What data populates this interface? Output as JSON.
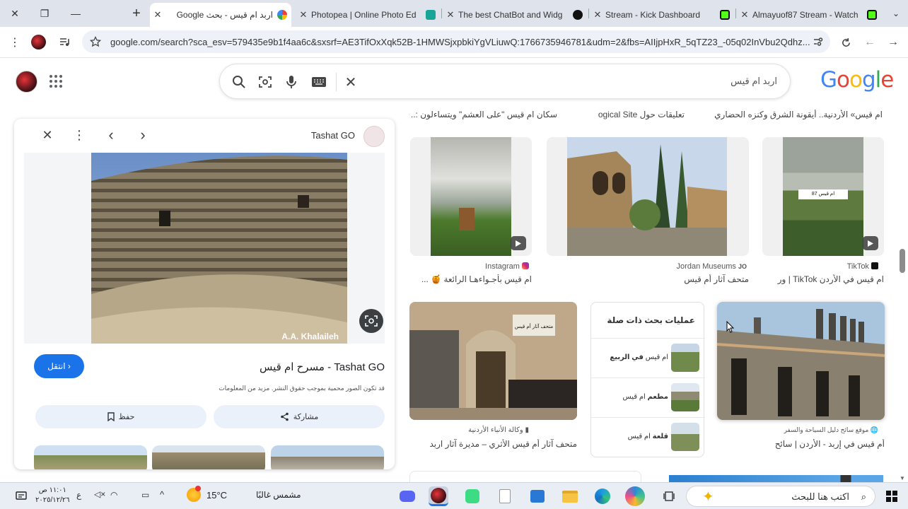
{
  "browser": {
    "tabs": [
      {
        "title": "اربد ام قيس - بحث Google",
        "active": true
      },
      {
        "title": "Photopea | Online Photo Ed",
        "active": false
      },
      {
        "title": "The best ChatBot and Widg",
        "active": false
      },
      {
        "title": "Stream - Kick Dashboard",
        "active": false
      },
      {
        "title": "Almayuof87 Stream - Watch",
        "active": false
      }
    ],
    "url": "google.com/search?sca_esv=579435e9b1f4aa6c&sxsrf=AE3TifOxXqk52B-1HMWSjxpbkiYgVLiuwQ:1766735946781&udm=2&fbs=AIIjpHxR_5qTZ23_-05q02InVbu2Qdhz..."
  },
  "search": {
    "query": "اربد ام قيس",
    "logo": "Google",
    "logo_colors": [
      "#4285F4",
      "#EA4335",
      "#FBBC05",
      "#4285F4",
      "#34A853",
      "#EA4335"
    ]
  },
  "panel": {
    "source": "Tashat GO",
    "visit_label": "انتقل",
    "title": "مسرح ام قيس - Tashat GO",
    "note": "قد تكون الصور محمية بموجب حقوق النشر. مزيد من المعلومات",
    "save_label": "حفظ",
    "share_label": "مشاركة",
    "watermark": "A.A. Khalaileh"
  },
  "top_captions": [
    "ام قيس» الأردنية.. أيقونة الشرق وكنزه الحضاري",
    "تعليقات حول ogical Site",
    "سكان ام قيس \"على العشم\" ويتساءلون :..."
  ],
  "results": [
    {
      "source": "TikTok",
      "caption": "ام قيس في الأردن TikTok | ور"
    },
    {
      "source": "Jordan Museums",
      "caption": "متحف آثار أم قيس"
    },
    {
      "source": "Instagram",
      "caption": "ام قيس بأجـواءهـا الرائعة 🍯 ..."
    },
    {
      "source": "وكالة الأنباء الأردنية",
      "caption": "متحف آثار أم قيس الأثري – مديرة آثار اربد"
    },
    {
      "source": "موقع سائح دليل السياحة والسفر",
      "caption": "أم قيس في إربد - الأردن | سائح"
    }
  ],
  "image_text": {
    "tiktok_overlay": "ام قيس 87",
    "museum_sign": "متحف آثار أم قيس"
  },
  "related": {
    "title": "عمليات بحث ذات صلة",
    "items": [
      {
        "bold": "في الربيع",
        "prefix": "ام قيس "
      },
      {
        "bold": "مطعم",
        "suffix": " ام قيس"
      },
      {
        "bold": "قلعة",
        "suffix": " ام قيس"
      }
    ]
  },
  "taskbar": {
    "search_placeholder": "اكتب هنا للبحث",
    "weather_temp": "15°C",
    "weather_text": "مشمس غالبًا",
    "time": "١١:٠١ ص",
    "date": "٢٠٢٥/١٢/٢٦",
    "lang": "ع"
  }
}
